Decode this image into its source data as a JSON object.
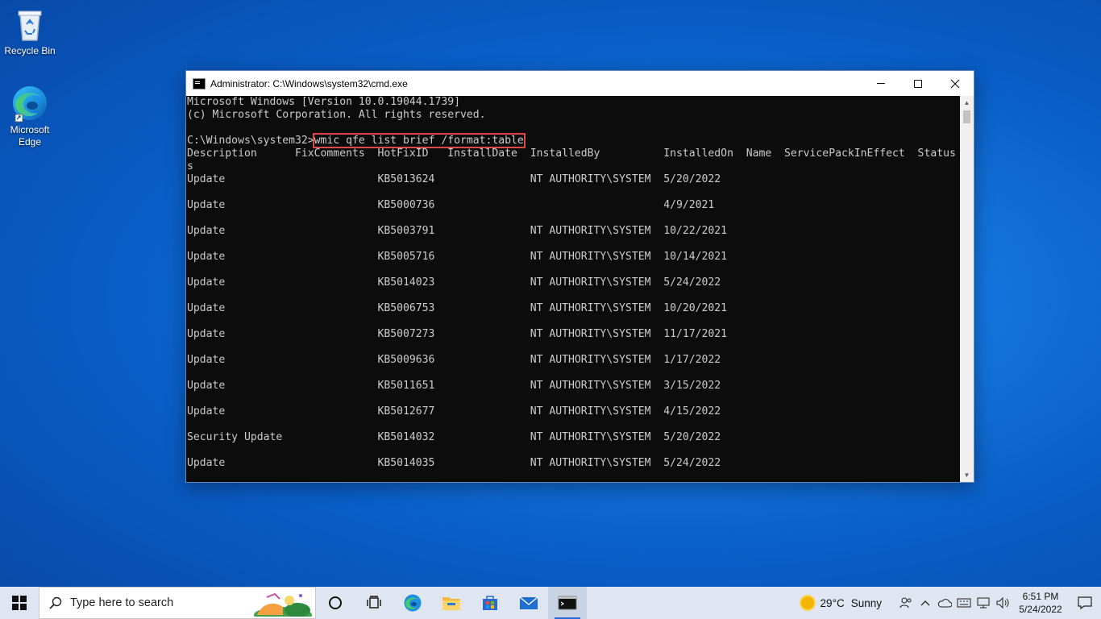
{
  "desktop": {
    "icons": [
      {
        "label": "Recycle Bin",
        "icon": "recycle-bin-icon"
      },
      {
        "label": "Microsoft Edge",
        "icon": "edge-icon"
      }
    ]
  },
  "window": {
    "title": "Administrator: C:\\Windows\\system32\\cmd.exe",
    "controls": {
      "minimize": "minimize-icon",
      "maximize": "maximize-icon",
      "close": "close-icon"
    },
    "console": {
      "header_lines": [
        "Microsoft Windows [Version 10.0.19044.1739]",
        "(c) Microsoft Corporation. All rights reserved.",
        ""
      ],
      "prompt": "C:\\Windows\\system32>",
      "command": "wmic qfe list brief /format:table",
      "table_header": "Description      FixComments  HotFixID   InstallDate  InstalledBy          InstalledOn  Name  ServicePackInEffect  Status",
      "table_header_wrap": "s",
      "rows": [
        {
          "description": "Update",
          "hotfix": "KB5013624",
          "installed_by": "NT AUTHORITY\\SYSTEM",
          "installed_on": "5/20/2022"
        },
        {
          "description": "Update",
          "hotfix": "KB5000736",
          "installed_by": "",
          "installed_on": "4/9/2021"
        },
        {
          "description": "Update",
          "hotfix": "KB5003791",
          "installed_by": "NT AUTHORITY\\SYSTEM",
          "installed_on": "10/22/2021"
        },
        {
          "description": "Update",
          "hotfix": "KB5005716",
          "installed_by": "NT AUTHORITY\\SYSTEM",
          "installed_on": "10/14/2021"
        },
        {
          "description": "Update",
          "hotfix": "KB5014023",
          "installed_by": "NT AUTHORITY\\SYSTEM",
          "installed_on": "5/24/2022"
        },
        {
          "description": "Update",
          "hotfix": "KB5006753",
          "installed_by": "NT AUTHORITY\\SYSTEM",
          "installed_on": "10/20/2021"
        },
        {
          "description": "Update",
          "hotfix": "KB5007273",
          "installed_by": "NT AUTHORITY\\SYSTEM",
          "installed_on": "11/17/2021"
        },
        {
          "description": "Update",
          "hotfix": "KB5009636",
          "installed_by": "NT AUTHORITY\\SYSTEM",
          "installed_on": "1/17/2022"
        },
        {
          "description": "Update",
          "hotfix": "KB5011651",
          "installed_by": "NT AUTHORITY\\SYSTEM",
          "installed_on": "3/15/2022"
        },
        {
          "description": "Update",
          "hotfix": "KB5012677",
          "installed_by": "NT AUTHORITY\\SYSTEM",
          "installed_on": "4/15/2022"
        },
        {
          "description": "Security Update",
          "hotfix": "KB5014032",
          "installed_by": "NT AUTHORITY\\SYSTEM",
          "installed_on": "5/20/2022"
        },
        {
          "description": "Update",
          "hotfix": "KB5014035",
          "installed_by": "NT AUTHORITY\\SYSTEM",
          "installed_on": "5/24/2022"
        }
      ]
    }
  },
  "taskbar": {
    "search_placeholder": "Type here to search",
    "apps": [
      "cortana-icon",
      "task-view-icon",
      "edge-icon",
      "file-explorer-icon",
      "store-icon",
      "mail-icon",
      "cmd-icon"
    ],
    "weather": {
      "temp": "29°C",
      "condition": "Sunny"
    },
    "clock": {
      "time": "6:51 PM",
      "date": "5/24/2022"
    }
  },
  "colors": {
    "console_bg": "#0c0c0c",
    "console_text": "#cccccc",
    "highlight": "#e04848",
    "taskbar_bg": "#dfe6f2"
  }
}
